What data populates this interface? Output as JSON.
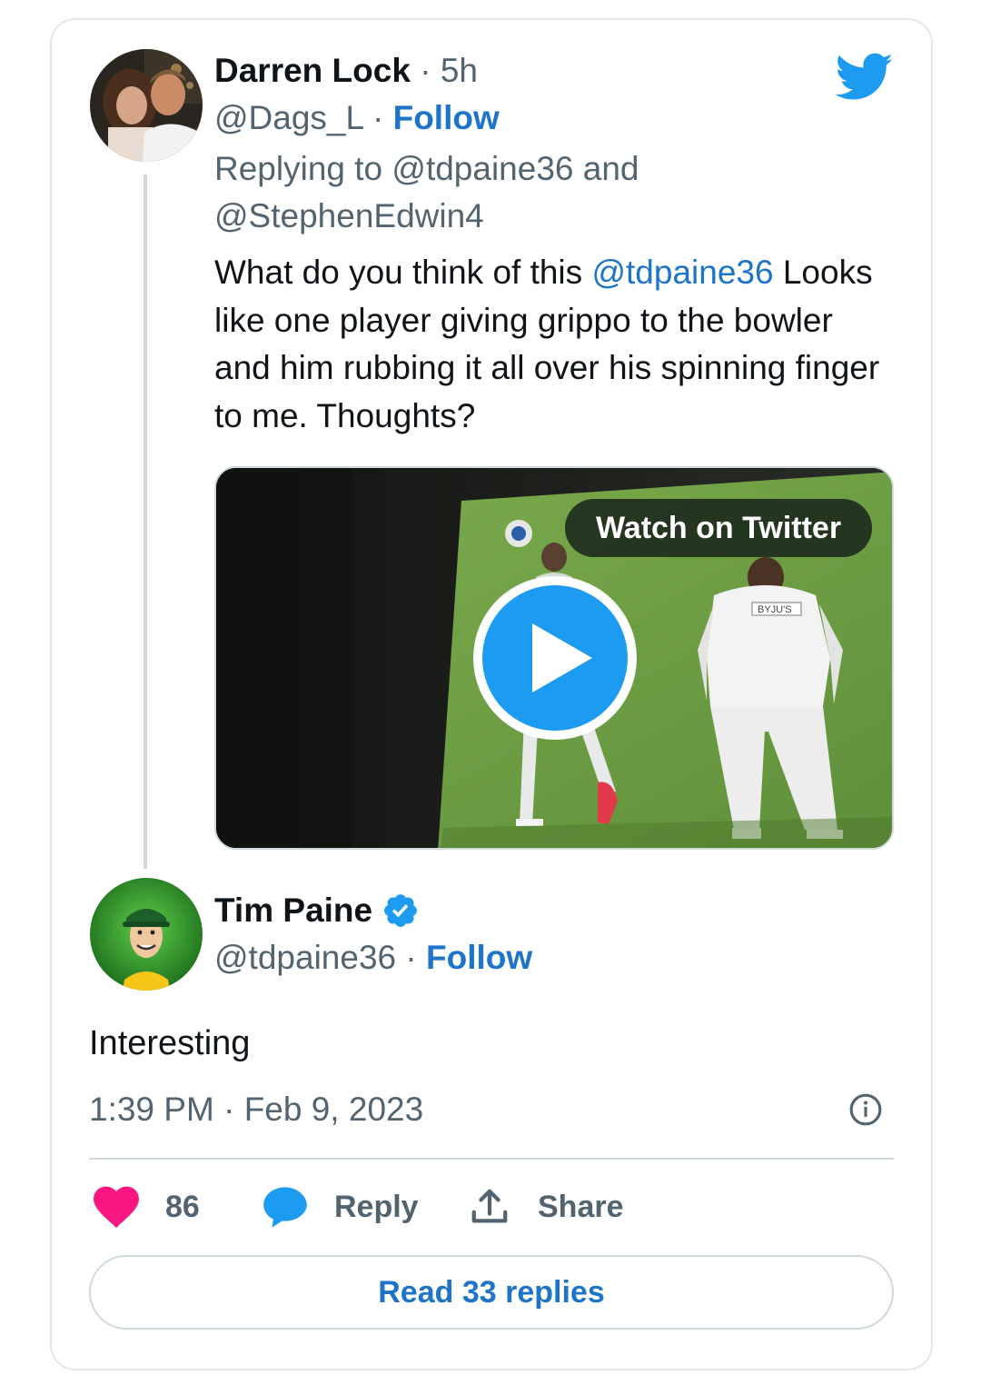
{
  "parent_tweet": {
    "author_name": "Darren Lock",
    "time_ago": "5h",
    "handle": "@Dags_L",
    "follow_label": "Follow",
    "replying_prefix": "Replying to",
    "replying_user_1": "@tdpaine36",
    "replying_and": "and",
    "replying_user_2": "@StephenEdwin4",
    "text_before_mention": "What do you think of this",
    "mention": "@tdpaine36",
    "text_after_mention": "Looks like one player giving grippo to the bowler and him rubbing it all over his spinning finger to me. Thoughts?",
    "media": {
      "watch_label": "Watch on Twitter",
      "shirt_sponsor": "BYJU'S"
    }
  },
  "reply_tweet": {
    "author_name": "Tim Paine",
    "verified": true,
    "handle": "@tdpaine36",
    "follow_label": "Follow",
    "text": "Interesting",
    "time": "1:39 PM",
    "date": "Feb 9, 2023"
  },
  "actions": {
    "like_count": "86",
    "reply_label": "Reply",
    "share_label": "Share"
  },
  "read_replies_label": "Read 33 replies",
  "separator": "·",
  "colors": {
    "link_blue": "#1d74c9",
    "twitter_blue": "#1d9bf0",
    "like_pink": "#f91880",
    "muted_gray": "#536471"
  }
}
